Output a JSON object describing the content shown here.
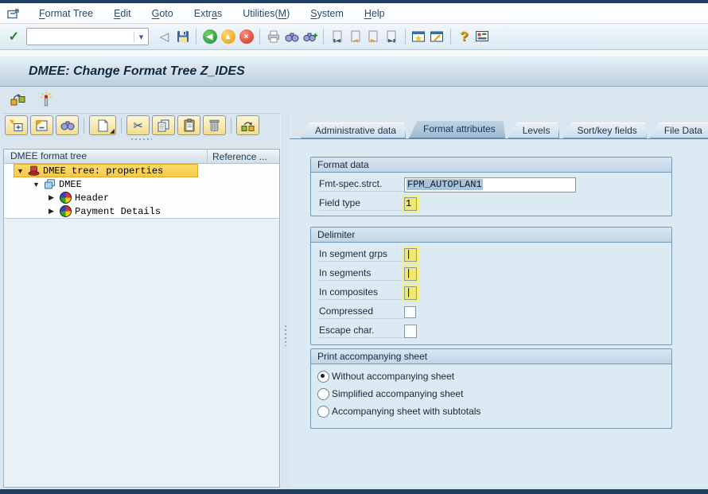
{
  "app": {
    "title": "DMEE: Change Format Tree Z_IDES"
  },
  "menu": {
    "items": [
      {
        "pre": "",
        "key": "F",
        "post": "ormat Tree"
      },
      {
        "pre": "",
        "key": "E",
        "post": "dit"
      },
      {
        "pre": "",
        "key": "G",
        "post": "oto"
      },
      {
        "pre": "Extr",
        "key": "a",
        "post": "s"
      },
      {
        "pre": "Utilities(",
        "key": "M",
        "post": ")"
      },
      {
        "pre": "",
        "key": "S",
        "post": "ystem"
      },
      {
        "pre": "",
        "key": "H",
        "post": "elp"
      }
    ]
  },
  "toolbar": {
    "command_value": "",
    "icons": [
      "enter",
      "command-field",
      "back",
      "save",
      "navigate-back",
      "exit",
      "cancel",
      "print",
      "find",
      "find-next",
      "first-page",
      "previous-page",
      "next-page",
      "last-page",
      "new-session",
      "create-shortcut",
      "help",
      "customize-layout"
    ]
  },
  "app_toolbar": {
    "icons": [
      "subtree-catalog",
      "activate-check"
    ]
  },
  "glyphs": {
    "enter": "✓",
    "back": "◁",
    "dropdown": "▾",
    "navigate_back": "◀",
    "exit": "▲",
    "cancel": "×",
    "help": "?",
    "cut": "✂",
    "reassign": "⇄",
    "expanded": "▼",
    "collapsed": "▶",
    "create_corner": "◢"
  },
  "left_panel": {
    "toolbar_icons": [
      "expand",
      "collapse",
      "find",
      "create-node",
      "cut",
      "copy",
      "paste",
      "delete",
      "reassign"
    ],
    "tree": {
      "columns": [
        "DMEE format tree",
        "Reference ..."
      ],
      "rows": [
        {
          "label": "DMEE tree: properties",
          "level": 0,
          "arrow": "▼",
          "icon": "tree-properties",
          "selected": true
        },
        {
          "label": "DMEE",
          "level": 1,
          "arrow": "▼",
          "icon": "format-node",
          "selected": false
        },
        {
          "label": "Header",
          "level": 2,
          "arrow": "▶",
          "icon": "segment-group",
          "selected": false
        },
        {
          "label": "Payment Details",
          "level": 2,
          "arrow": "▶",
          "icon": "segment-group",
          "selected": false
        }
      ]
    }
  },
  "tabs": {
    "items": [
      {
        "label": "Administrative data",
        "active": false
      },
      {
        "label": "Format attributes",
        "active": true
      },
      {
        "label": "Levels",
        "active": false
      },
      {
        "label": "Sort/key fields",
        "active": false
      },
      {
        "label": "File Data",
        "active": false
      }
    ]
  },
  "format_data": {
    "title": "Format data",
    "fmt_label": "Fmt-spec.strct.",
    "fmt_value": "FPM_AUTOPLAN1",
    "type_label": "Field type",
    "type_value": "1"
  },
  "delimiter": {
    "title": "Delimiter",
    "rows": [
      {
        "label": "In segment grps",
        "value": "|",
        "type": "text-marked"
      },
      {
        "label": "In segments",
        "value": "|",
        "type": "text-marked"
      },
      {
        "label": "In composites",
        "value": "|",
        "type": "text-marked"
      },
      {
        "label": "Compressed",
        "value": "unchecked",
        "type": "checkbox"
      },
      {
        "label": "Escape char.",
        "value": "",
        "type": "text"
      }
    ]
  },
  "print_sheet": {
    "title": "Print accompanying sheet",
    "options": [
      {
        "label": "Without accompanying sheet",
        "selected": true
      },
      {
        "label": "Simplified accompanying sheet",
        "selected": false
      },
      {
        "label": "Accompanying sheet with subtotals",
        "selected": false
      }
    ]
  },
  "colors": {
    "selection_gold": "#f8d55e",
    "marked_field": "#f2e96e",
    "active_tab": "#a9c2d8",
    "title_bar": "#bdd2e2",
    "top_strip": "#1e4066",
    "value_selection": "#a9c3da"
  }
}
